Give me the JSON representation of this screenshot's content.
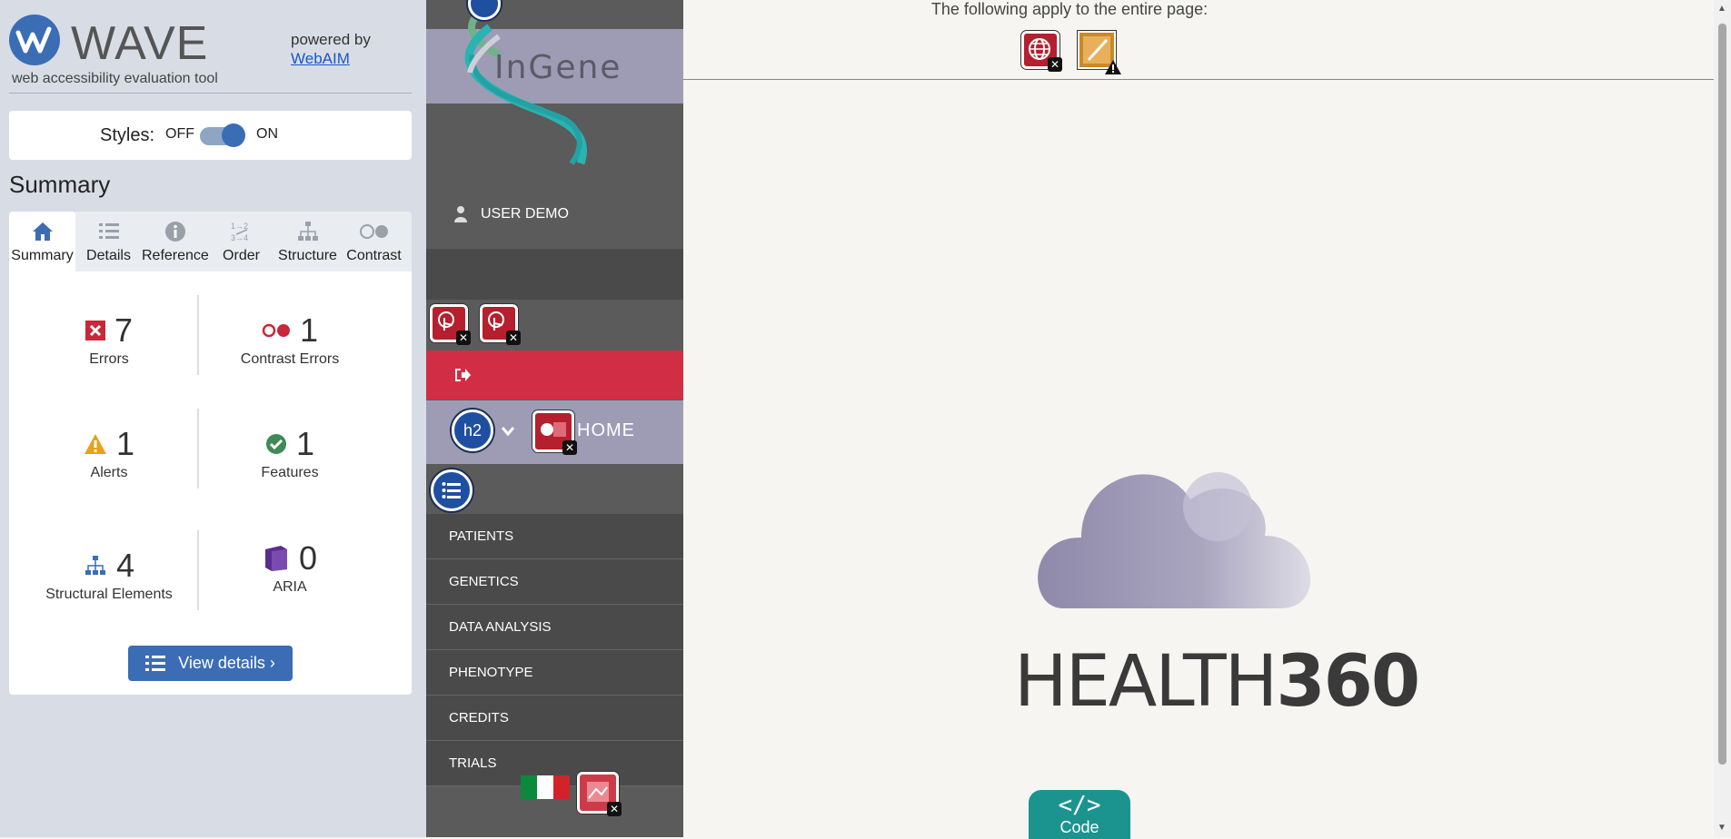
{
  "wave": {
    "title": "WAVE",
    "tagline": "web accessibility evaluation tool",
    "powered_by": "powered by",
    "webaim_link": "WebAIM",
    "styles_label": "Styles:",
    "toggle_off": "OFF",
    "toggle_on": "ON",
    "summary_heading": "Summary",
    "tabs": [
      {
        "label": "Summary",
        "icon": "home-icon"
      },
      {
        "label": "Details",
        "icon": "list-icon"
      },
      {
        "label": "Reference",
        "icon": "info-icon"
      },
      {
        "label": "Order",
        "icon": "order-icon"
      },
      {
        "label": "Structure",
        "icon": "structure-icon"
      },
      {
        "label": "Contrast",
        "icon": "contrast-icon"
      }
    ],
    "stats": {
      "errors": {
        "count": "7",
        "label": "Errors"
      },
      "contrast": {
        "count": "1",
        "label": "Contrast Errors"
      },
      "alerts": {
        "count": "1",
        "label": "Alerts"
      },
      "features": {
        "count": "1",
        "label": "Features"
      },
      "structural": {
        "count": "4",
        "label": "Structural Elements"
      },
      "aria": {
        "count": "0",
        "label": "ARIA"
      }
    },
    "view_details": "View details ›"
  },
  "site": {
    "brand": "InGene",
    "user": "USER DEMO",
    "home": "HOME",
    "h2_badge": "h2",
    "nav": [
      "PATIENTS",
      "GENETICS",
      "DATA ANALYSIS",
      "PHENOTYPE",
      "CREDITS",
      "TRIALS"
    ]
  },
  "main": {
    "page_notice": "The following apply to the entire page:",
    "health_prefix": "HEALTH",
    "health_suffix": "360",
    "code_label": "Code",
    "code_glyph": "</>"
  },
  "colors": {
    "wave_blue": "#3b6db5",
    "error_red": "#b51f2e",
    "nav_bg": "#5b5b5b",
    "lavender": "#9e9cb5",
    "logout_red": "#d12e45",
    "code_teal": "#1b9490"
  }
}
